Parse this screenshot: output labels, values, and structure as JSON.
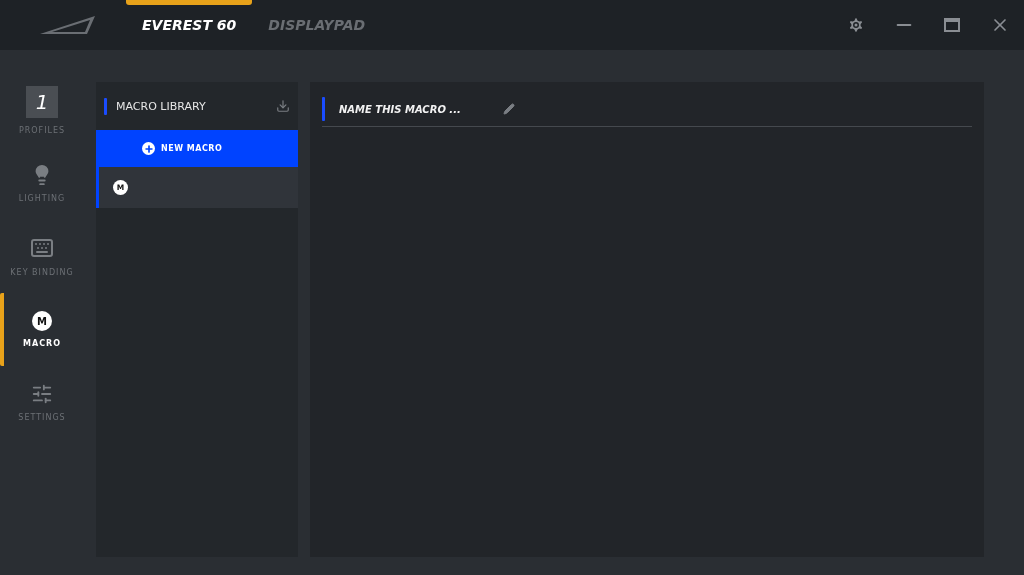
{
  "devices": [
    {
      "label": "EVEREST 60",
      "selected": true
    },
    {
      "label": "DISPLAYPAD",
      "selected": false
    }
  ],
  "nav": [
    {
      "kind": "profile",
      "number": "1",
      "label": "PROFILES",
      "selected": false
    },
    {
      "kind": "lighting",
      "label": "LIGHTING",
      "selected": false
    },
    {
      "kind": "keyboard",
      "label": "KEY BINDING",
      "selected": false
    },
    {
      "kind": "macro",
      "letter": "M",
      "label": "MACRO",
      "selected": true
    },
    {
      "kind": "settings",
      "label": "SETTINGS",
      "selected": false
    }
  ],
  "library": {
    "title": "MACRO LIBRARY",
    "new_button": "NEW MACRO",
    "items": [
      {
        "letter": "M",
        "selected": true
      }
    ]
  },
  "editor": {
    "name_field": {
      "placeholder": "NAME THIS MACRO ..."
    }
  }
}
